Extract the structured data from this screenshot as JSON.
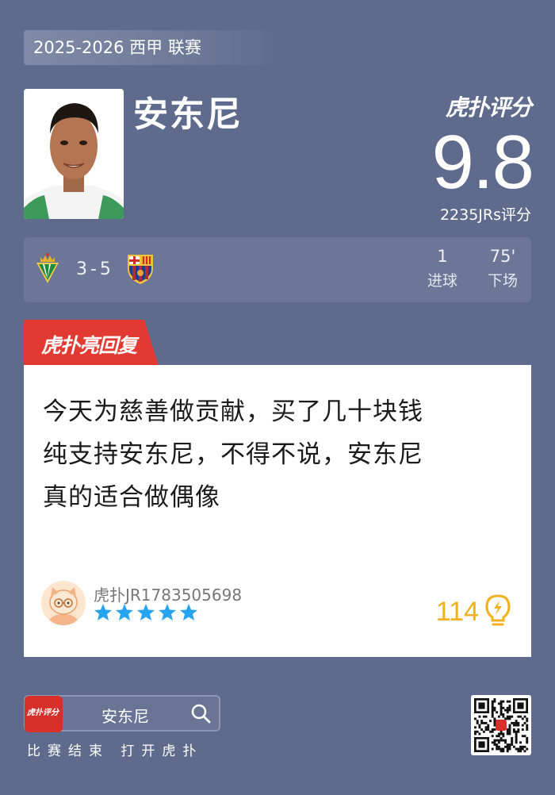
{
  "header": {
    "season_label": "2025-2026 西甲 联赛"
  },
  "player": {
    "name": "安东尼"
  },
  "rating": {
    "brand": "虎扑评分",
    "score": "9.8",
    "votes_label": "2235JRs评分"
  },
  "match": {
    "score": "3-5",
    "home_crest": "real-betis-crest-icon",
    "away_crest": "fc-barcelona-crest-icon",
    "stats": [
      {
        "value": "1",
        "label": "进球"
      },
      {
        "value": "75'",
        "label": "下场"
      }
    ]
  },
  "highlight_tag": {
    "text": "虎扑亮回复"
  },
  "comment": {
    "lines": [
      "今天为慈善做贡献，买了几十块钱",
      "纯支持安东尼，不得不说，安东尼",
      "真的适合做偶像"
    ],
    "username": "虎扑JR1783505698",
    "stars": 5,
    "likes": "114"
  },
  "footer": {
    "app_icon_text": "虎扑评分",
    "search_text": "安东尼",
    "caption": "比赛结束 打开虎扑"
  },
  "colors": {
    "background": "#5f6b8c",
    "tag_red": "#e23a33",
    "star_blue": "#27a4ef",
    "likes_gold": "#f2b01d"
  }
}
